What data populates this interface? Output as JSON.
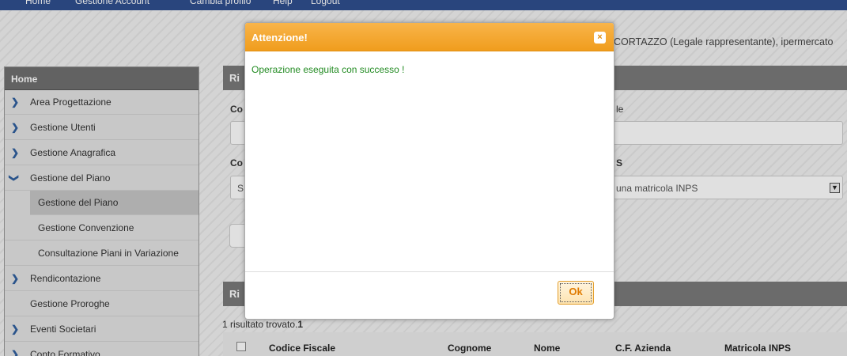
{
  "topnav": {
    "items": [
      "Home",
      "Gestione Account",
      "Cambia profilo",
      "Help",
      "Logout"
    ]
  },
  "header": {
    "user_info": "CORTAZZO (Legale rappresentante), ipermercato"
  },
  "sidebar": {
    "header": "Home",
    "items": [
      {
        "label": "Area Progettazione"
      },
      {
        "label": "Gestione Utenti"
      },
      {
        "label": "Gestione Anagrafica"
      },
      {
        "label": "Gestione del Piano"
      },
      {
        "label": "Gestione del Piano"
      },
      {
        "label": "Gestione Convenzione"
      },
      {
        "label": "Consultazione Piani in Variazione"
      },
      {
        "label": "Rendicontazione"
      },
      {
        "label": "Gestione Proroghe"
      },
      {
        "label": "Eventi Societari"
      },
      {
        "label": "Conto Formativo"
      }
    ]
  },
  "main": {
    "search_panel_title": "Ri",
    "results_panel_title": "Ri",
    "label_codice_fiscale": "Co",
    "label_codice_fiscale_right": "le",
    "label_codice": "Co",
    "label_matricola": "S",
    "select_partial": "S",
    "matricola_placeholder": "una matricola INPS",
    "results_count_text": "1 risultato trovato.",
    "results_count_num": "1",
    "table_columns": [
      "Codice Fiscale",
      "Cognome",
      "Nome",
      "C.F. Azienda",
      "Matricola INPS"
    ]
  },
  "modal": {
    "title": "Attenzione!",
    "close_glyph": "×",
    "message": "Operazione eseguita con successo !",
    "ok_label": "Ok"
  },
  "colors": {
    "modal_title_bg": "#f09d1d",
    "success_text": "#228b22",
    "sidebar_header_bg": "#707070",
    "chevron": "#2f5f9f"
  }
}
